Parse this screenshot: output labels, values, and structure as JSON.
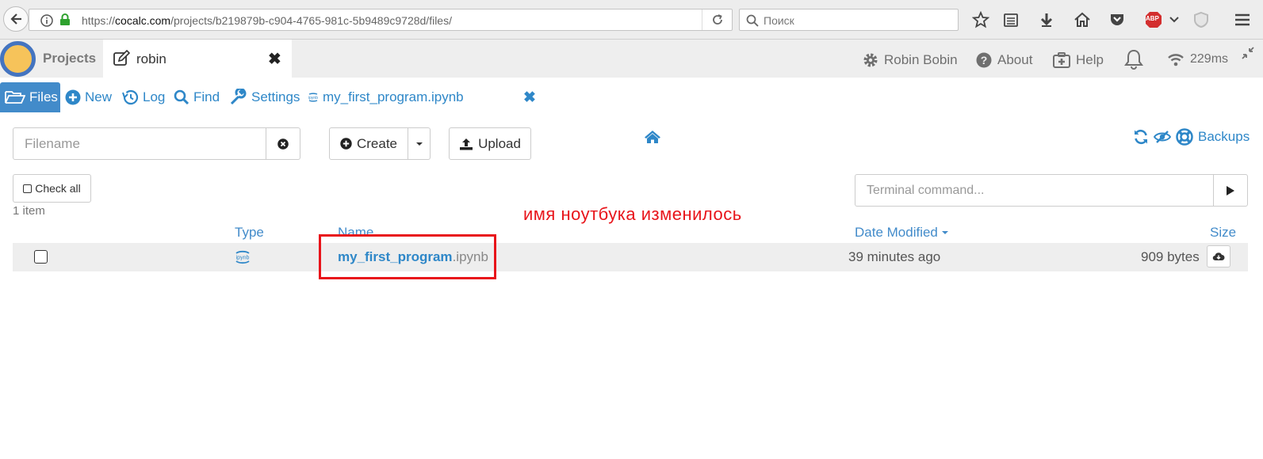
{
  "browser": {
    "url_prefix": "https://",
    "url_domain": "cocalc.com",
    "url_path": "/projects/b219879b-c904-4765-981c-5b9489c9728d/files/",
    "search_placeholder": "Поиск",
    "abp_label": "ABP"
  },
  "nav": {
    "projects_label": "Projects",
    "project_tab_name": "robin",
    "close_glyph": "✖",
    "user_name": "Robin Bobin",
    "about_label": "About",
    "help_label": "Help",
    "ping": "229ms"
  },
  "tabs": {
    "files": "Files",
    "new": "New",
    "log": "Log",
    "find": "Find",
    "settings": "Settings",
    "open_file": "my_first_program.ipynb",
    "close_glyph": "✖"
  },
  "controls": {
    "filename_placeholder": "Filename",
    "create_label": "Create",
    "upload_label": "Upload",
    "backups_label": "Backups",
    "check_all_label": "Check all",
    "item_count": "1 item",
    "terminal_placeholder": "Terminal command..."
  },
  "annotation": "имя ноутбука изменилось",
  "listing": {
    "columns": {
      "type": "Type",
      "name": "Name",
      "date": "Date Modified",
      "size": "Size"
    },
    "rows": [
      {
        "type_icon_label": "ipynb",
        "name_base": "my_first_program",
        "name_ext": ".ipynb",
        "date": "39 minutes ago",
        "size": "909 bytes"
      }
    ]
  },
  "colors": {
    "link": "#428bca",
    "annotation": "#e8141a",
    "files_tab_bg": "#428bca"
  }
}
